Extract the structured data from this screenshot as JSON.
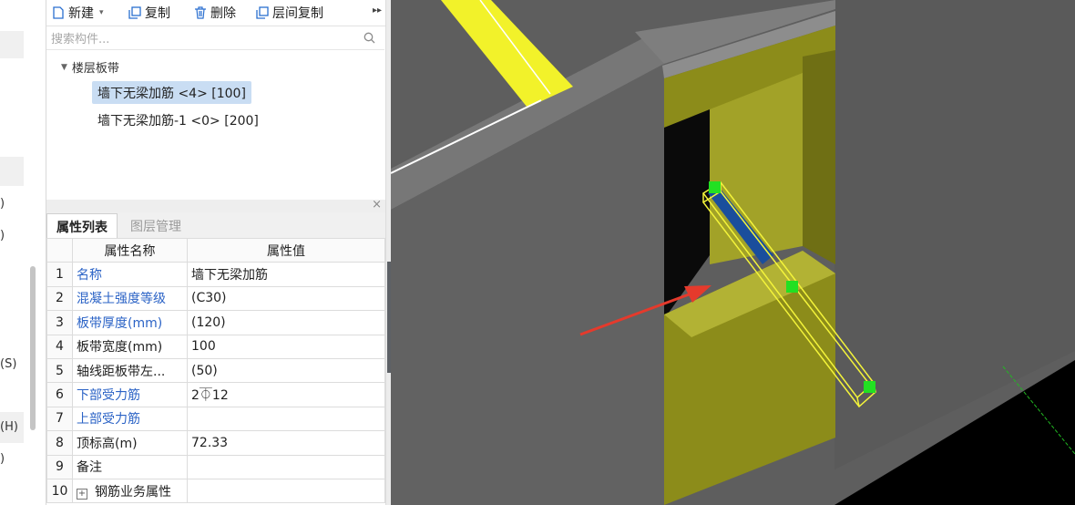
{
  "left_strip": {
    "labels": [
      ")",
      ")",
      "(S)",
      "(H)",
      ")"
    ]
  },
  "toolbar": {
    "new_label": "新建",
    "copy_label": "复制",
    "delete_label": "删除",
    "floor_copy_label": "层间复制",
    "more_icon": "double-chevron-right-icon"
  },
  "search": {
    "placeholder": "搜索构件..."
  },
  "tree": {
    "root_label": "楼层板带",
    "items": [
      {
        "label": "墙下无梁加筋 <4> [100]",
        "selected": true
      },
      {
        "label": "墙下无梁加筋-1 <0> [200]",
        "selected": false
      }
    ]
  },
  "props": {
    "tabs": [
      "属性列表",
      "图层管理"
    ],
    "col_name": "属性名称",
    "col_value": "属性值",
    "rows": [
      {
        "num": "1",
        "name": "名称",
        "value": "墙下无梁加筋",
        "color": "#2b63c6"
      },
      {
        "num": "2",
        "name": "混凝土强度等级",
        "value": "(C30)",
        "color": "#2b63c6"
      },
      {
        "num": "3",
        "name": "板带厚度(mm)",
        "value": "(120)",
        "color": "#2b63c6"
      },
      {
        "num": "4",
        "name": "板带宽度(mm)",
        "value": "100",
        "color": "#222222"
      },
      {
        "num": "5",
        "name": "轴线距板带左...",
        "value": "(50)",
        "color": "#222222"
      },
      {
        "num": "6",
        "name": "下部受力筋",
        "value": "2⏁12",
        "color": "#2b63c6"
      },
      {
        "num": "7",
        "name": "上部受力筋",
        "value": "",
        "color": "#2b63c6"
      },
      {
        "num": "8",
        "name": "顶标高(m)",
        "value": "72.33",
        "color": "#222222"
      },
      {
        "num": "9",
        "name": "备注",
        "value": "",
        "color": "#222222"
      },
      {
        "num": "10",
        "name": "钢筋业务属性",
        "value": "",
        "color": "#222222",
        "expandable": true
      }
    ]
  },
  "colors": {
    "selection": "#c9ddf3",
    "link_blue": "#2b63c6",
    "wall_gray": "#5e5e5e",
    "olive": "#9a9a1c",
    "yellow": "#f2f22a",
    "grip_green": "#22e022",
    "arrow_red": "#e53a2c"
  }
}
